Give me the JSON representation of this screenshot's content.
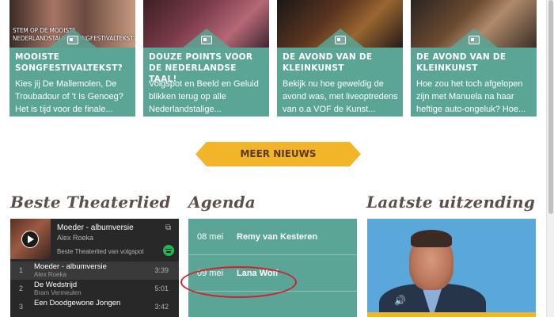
{
  "news_cards": [
    {
      "overlay_text": "STEM OP DE MOOISTE NEDERLANDSTALIGE SONGFESTIVALTEKST",
      "title": "MOOISTE SONGFESTIVALTEKST?",
      "description": "Kies jij De Mallemolen, De Troubadour of 't Is Genoeg? Het is tijd voor de finale..."
    },
    {
      "overlay_text": "",
      "title": "DOUZE POINTS VOOR DE NEDERLANDSE TAAL!",
      "description": "Volgspot en Beeld en Geluid blikken terug op alle Nederlandstalige..."
    },
    {
      "overlay_text": "",
      "title": "DE AVOND VAN DE KLEINKUNST",
      "description": "Bekijk nu hoe geweldig de avond was, met liveoptredens van o.a VOF de Kunst..."
    },
    {
      "overlay_text": "",
      "title": "DE AVOND VAN DE KLEINKUNST",
      "description": "Hoe zou het toch afgelopen zijn met Manuela na haar heftige auto-ongeluk? Hoe..."
    }
  ],
  "meer_nieuws_label": "MEER NIEUWS",
  "sections": {
    "theaterlied": "Beste Theaterlied",
    "agenda": "Agenda",
    "uitzending": "Laatste uitzending"
  },
  "player": {
    "now_playing_title": "Moeder - albumversie",
    "now_playing_artist": "Alex Roeka",
    "playlist": "Beste Theaterlied van volgspot",
    "tracks": [
      {
        "num": "1",
        "title": "Moeder - albumversie",
        "artist": "Alex Roeka",
        "duration": "3:39"
      },
      {
        "num": "2",
        "title": "De Wedstrijd",
        "artist": "Bram Vermeulen",
        "duration": "5:01"
      },
      {
        "num": "3",
        "title": "Een Doodgewone Jongen",
        "artist": "",
        "duration": "3:42"
      }
    ]
  },
  "agenda": [
    {
      "date": "08 mei",
      "name": "Remy van Kesteren"
    },
    {
      "date": "09 mei",
      "name": "Lana Wolf"
    },
    {
      "date": "",
      "name": ""
    }
  ],
  "colors": {
    "teal": "#5aa595",
    "yellow": "#f2b52a",
    "heading": "#5a4f4a",
    "highlight": "#d0202a"
  }
}
